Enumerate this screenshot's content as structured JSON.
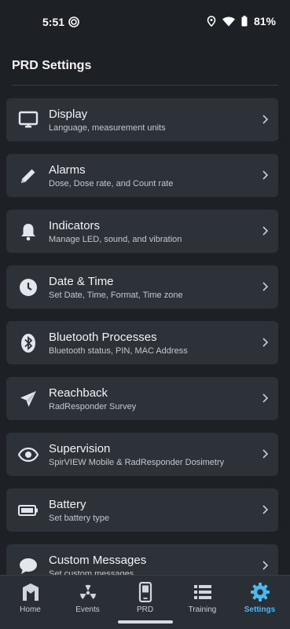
{
  "status": {
    "time": "5:51",
    "battery": "81%"
  },
  "header": {
    "title": "PRD Settings"
  },
  "items": [
    {
      "title": "Display",
      "subtitle": "Language, measurement units",
      "icon": "monitor-icon"
    },
    {
      "title": "Alarms",
      "subtitle": "Dose, Dose rate, and Count rate",
      "icon": "pencil-icon"
    },
    {
      "title": "Indicators",
      "subtitle": "Manage LED, sound, and vibration",
      "icon": "bell-icon"
    },
    {
      "title": "Date & Time",
      "subtitle": "Set Date, Time, Format, Time zone",
      "icon": "clock-icon"
    },
    {
      "title": "Bluetooth Processes",
      "subtitle": "Bluetooth status, PIN, MAC Address",
      "icon": "bluetooth-icon"
    },
    {
      "title": "Reachback",
      "subtitle": "RadResponder Survey",
      "icon": "send-icon"
    },
    {
      "title": "Supervision",
      "subtitle": "SpirVIEW Mobile & RadResponder Dosimetry",
      "icon": "eye-icon"
    },
    {
      "title": "Battery",
      "subtitle": "Set battery type",
      "icon": "battery-icon"
    },
    {
      "title": "Custom Messages",
      "subtitle": "Set custom messages",
      "icon": "chat-icon"
    }
  ],
  "nav": [
    {
      "label": "Home",
      "icon": "home-logo-icon"
    },
    {
      "label": "Events",
      "icon": "radiation-icon"
    },
    {
      "label": "PRD",
      "icon": "phone-icon"
    },
    {
      "label": "Training",
      "icon": "list-icon"
    },
    {
      "label": "Settings",
      "icon": "gear-icon",
      "active": true
    }
  ],
  "colors": {
    "accent": "#4db7f0",
    "card": "#2d3238",
    "background": "#1d2024"
  }
}
